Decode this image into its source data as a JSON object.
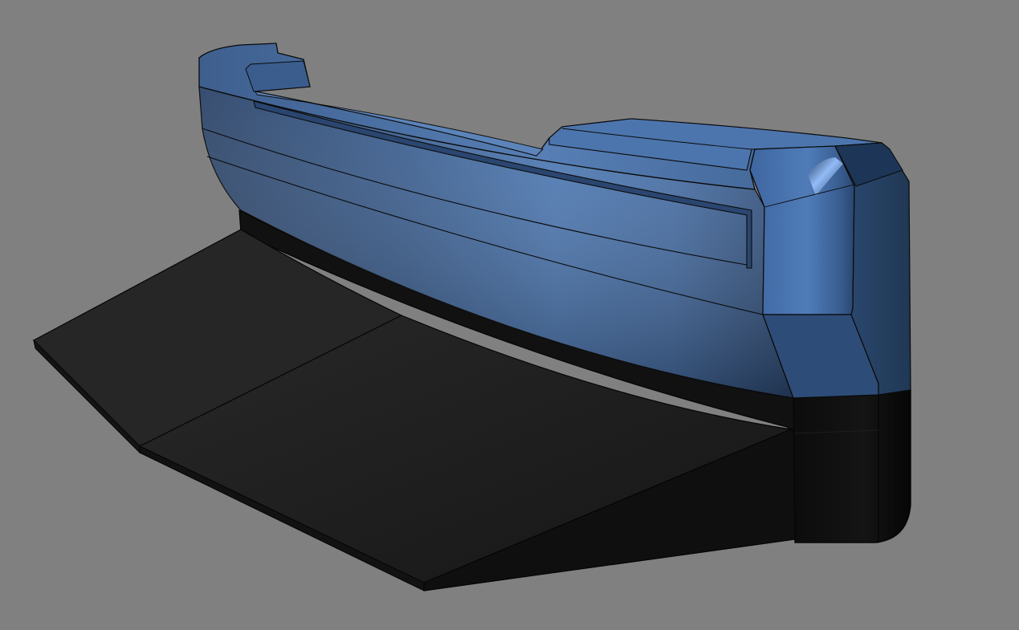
{
  "scene": {
    "subject": "bumper-model",
    "background_color": "#808080",
    "body_color": "#3f6aa6",
    "body_highlight_color": "#6a96d0",
    "body_shadow_color": "#1f3350",
    "splitter_color": "#1c1c1c",
    "edge_color": "#0a0a0a"
  }
}
